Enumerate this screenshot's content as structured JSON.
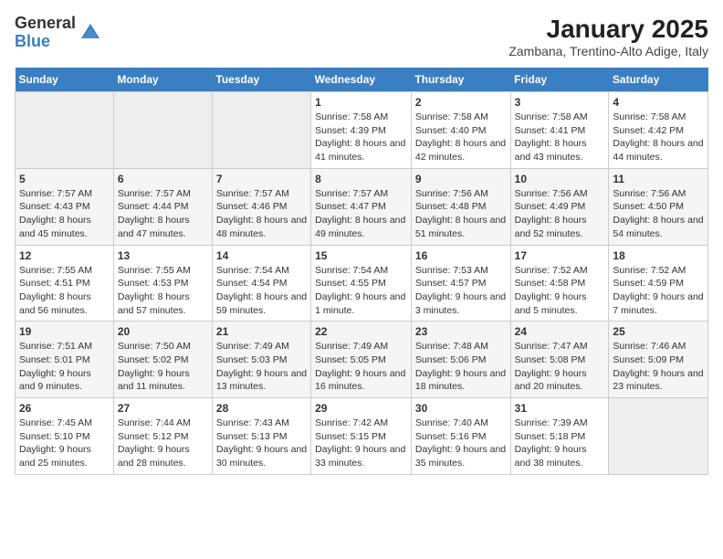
{
  "logo": {
    "general": "General",
    "blue": "Blue"
  },
  "header": {
    "title": "January 2025",
    "subtitle": "Zambana, Trentino-Alto Adige, Italy"
  },
  "weekdays": [
    "Sunday",
    "Monday",
    "Tuesday",
    "Wednesday",
    "Thursday",
    "Friday",
    "Saturday"
  ],
  "weeks": [
    [
      {
        "day": "",
        "empty": true
      },
      {
        "day": "",
        "empty": true
      },
      {
        "day": "",
        "empty": true
      },
      {
        "day": "1",
        "sunrise": "7:58 AM",
        "sunset": "4:39 PM",
        "daylight": "8 hours and 41 minutes."
      },
      {
        "day": "2",
        "sunrise": "7:58 AM",
        "sunset": "4:40 PM",
        "daylight": "8 hours and 42 minutes."
      },
      {
        "day": "3",
        "sunrise": "7:58 AM",
        "sunset": "4:41 PM",
        "daylight": "8 hours and 43 minutes."
      },
      {
        "day": "4",
        "sunrise": "7:58 AM",
        "sunset": "4:42 PM",
        "daylight": "8 hours and 44 minutes."
      }
    ],
    [
      {
        "day": "5",
        "sunrise": "7:57 AM",
        "sunset": "4:43 PM",
        "daylight": "8 hours and 45 minutes."
      },
      {
        "day": "6",
        "sunrise": "7:57 AM",
        "sunset": "4:44 PM",
        "daylight": "8 hours and 47 minutes."
      },
      {
        "day": "7",
        "sunrise": "7:57 AM",
        "sunset": "4:46 PM",
        "daylight": "8 hours and 48 minutes."
      },
      {
        "day": "8",
        "sunrise": "7:57 AM",
        "sunset": "4:47 PM",
        "daylight": "8 hours and 49 minutes."
      },
      {
        "day": "9",
        "sunrise": "7:56 AM",
        "sunset": "4:48 PM",
        "daylight": "8 hours and 51 minutes."
      },
      {
        "day": "10",
        "sunrise": "7:56 AM",
        "sunset": "4:49 PM",
        "daylight": "8 hours and 52 minutes."
      },
      {
        "day": "11",
        "sunrise": "7:56 AM",
        "sunset": "4:50 PM",
        "daylight": "8 hours and 54 minutes."
      }
    ],
    [
      {
        "day": "12",
        "sunrise": "7:55 AM",
        "sunset": "4:51 PM",
        "daylight": "8 hours and 56 minutes."
      },
      {
        "day": "13",
        "sunrise": "7:55 AM",
        "sunset": "4:53 PM",
        "daylight": "8 hours and 57 minutes."
      },
      {
        "day": "14",
        "sunrise": "7:54 AM",
        "sunset": "4:54 PM",
        "daylight": "8 hours and 59 minutes."
      },
      {
        "day": "15",
        "sunrise": "7:54 AM",
        "sunset": "4:55 PM",
        "daylight": "9 hours and 1 minute."
      },
      {
        "day": "16",
        "sunrise": "7:53 AM",
        "sunset": "4:57 PM",
        "daylight": "9 hours and 3 minutes."
      },
      {
        "day": "17",
        "sunrise": "7:52 AM",
        "sunset": "4:58 PM",
        "daylight": "9 hours and 5 minutes."
      },
      {
        "day": "18",
        "sunrise": "7:52 AM",
        "sunset": "4:59 PM",
        "daylight": "9 hours and 7 minutes."
      }
    ],
    [
      {
        "day": "19",
        "sunrise": "7:51 AM",
        "sunset": "5:01 PM",
        "daylight": "9 hours and 9 minutes."
      },
      {
        "day": "20",
        "sunrise": "7:50 AM",
        "sunset": "5:02 PM",
        "daylight": "9 hours and 11 minutes."
      },
      {
        "day": "21",
        "sunrise": "7:49 AM",
        "sunset": "5:03 PM",
        "daylight": "9 hours and 13 minutes."
      },
      {
        "day": "22",
        "sunrise": "7:49 AM",
        "sunset": "5:05 PM",
        "daylight": "9 hours and 16 minutes."
      },
      {
        "day": "23",
        "sunrise": "7:48 AM",
        "sunset": "5:06 PM",
        "daylight": "9 hours and 18 minutes."
      },
      {
        "day": "24",
        "sunrise": "7:47 AM",
        "sunset": "5:08 PM",
        "daylight": "9 hours and 20 minutes."
      },
      {
        "day": "25",
        "sunrise": "7:46 AM",
        "sunset": "5:09 PM",
        "daylight": "9 hours and 23 minutes."
      }
    ],
    [
      {
        "day": "26",
        "sunrise": "7:45 AM",
        "sunset": "5:10 PM",
        "daylight": "9 hours and 25 minutes."
      },
      {
        "day": "27",
        "sunrise": "7:44 AM",
        "sunset": "5:12 PM",
        "daylight": "9 hours and 28 minutes."
      },
      {
        "day": "28",
        "sunrise": "7:43 AM",
        "sunset": "5:13 PM",
        "daylight": "9 hours and 30 minutes."
      },
      {
        "day": "29",
        "sunrise": "7:42 AM",
        "sunset": "5:15 PM",
        "daylight": "9 hours and 33 minutes."
      },
      {
        "day": "30",
        "sunrise": "7:40 AM",
        "sunset": "5:16 PM",
        "daylight": "9 hours and 35 minutes."
      },
      {
        "day": "31",
        "sunrise": "7:39 AM",
        "sunset": "5:18 PM",
        "daylight": "9 hours and 38 minutes."
      },
      {
        "day": "",
        "empty": true
      }
    ]
  ]
}
